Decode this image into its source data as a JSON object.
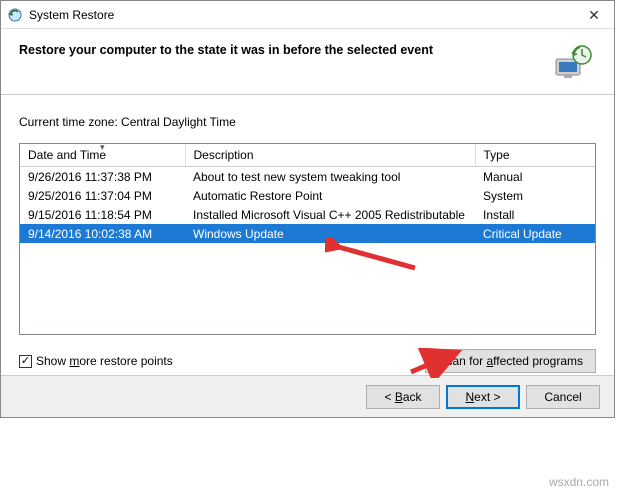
{
  "window": {
    "title": "System Restore",
    "close_glyph": "✕"
  },
  "header": {
    "heading": "Restore your computer to the state it was in before the selected event"
  },
  "timezone_label": "Current time zone: Central Daylight Time",
  "table": {
    "columns": {
      "date": "Date and Time",
      "desc": "Description",
      "type": "Type"
    },
    "rows": [
      {
        "date": "9/26/2016 11:37:38 PM",
        "desc": "About to test new system tweaking tool",
        "type": "Manual",
        "selected": false
      },
      {
        "date": "9/25/2016 11:37:04 PM",
        "desc": "Automatic Restore Point",
        "type": "System",
        "selected": false
      },
      {
        "date": "9/15/2016 11:18:54 PM",
        "desc": "Installed Microsoft Visual C++ 2005 Redistributable",
        "type": "Install",
        "selected": false
      },
      {
        "date": "9/14/2016 10:02:38 AM",
        "desc": "Windows Update",
        "type": "Critical Update",
        "selected": true
      }
    ]
  },
  "checkbox": {
    "label_pre": "Show ",
    "label_u": "m",
    "label_post": "ore restore points",
    "checked": true,
    "check_glyph": "✓"
  },
  "scan_button": {
    "label_pre": "Scan for ",
    "label_u": "a",
    "label_post": "ffected programs"
  },
  "footer": {
    "back": {
      "pre": "< ",
      "u": "B",
      "post": "ack"
    },
    "next": {
      "u": "N",
      "post": "ext >"
    },
    "cancel": "Cancel"
  },
  "watermark": "wsxdn.com"
}
